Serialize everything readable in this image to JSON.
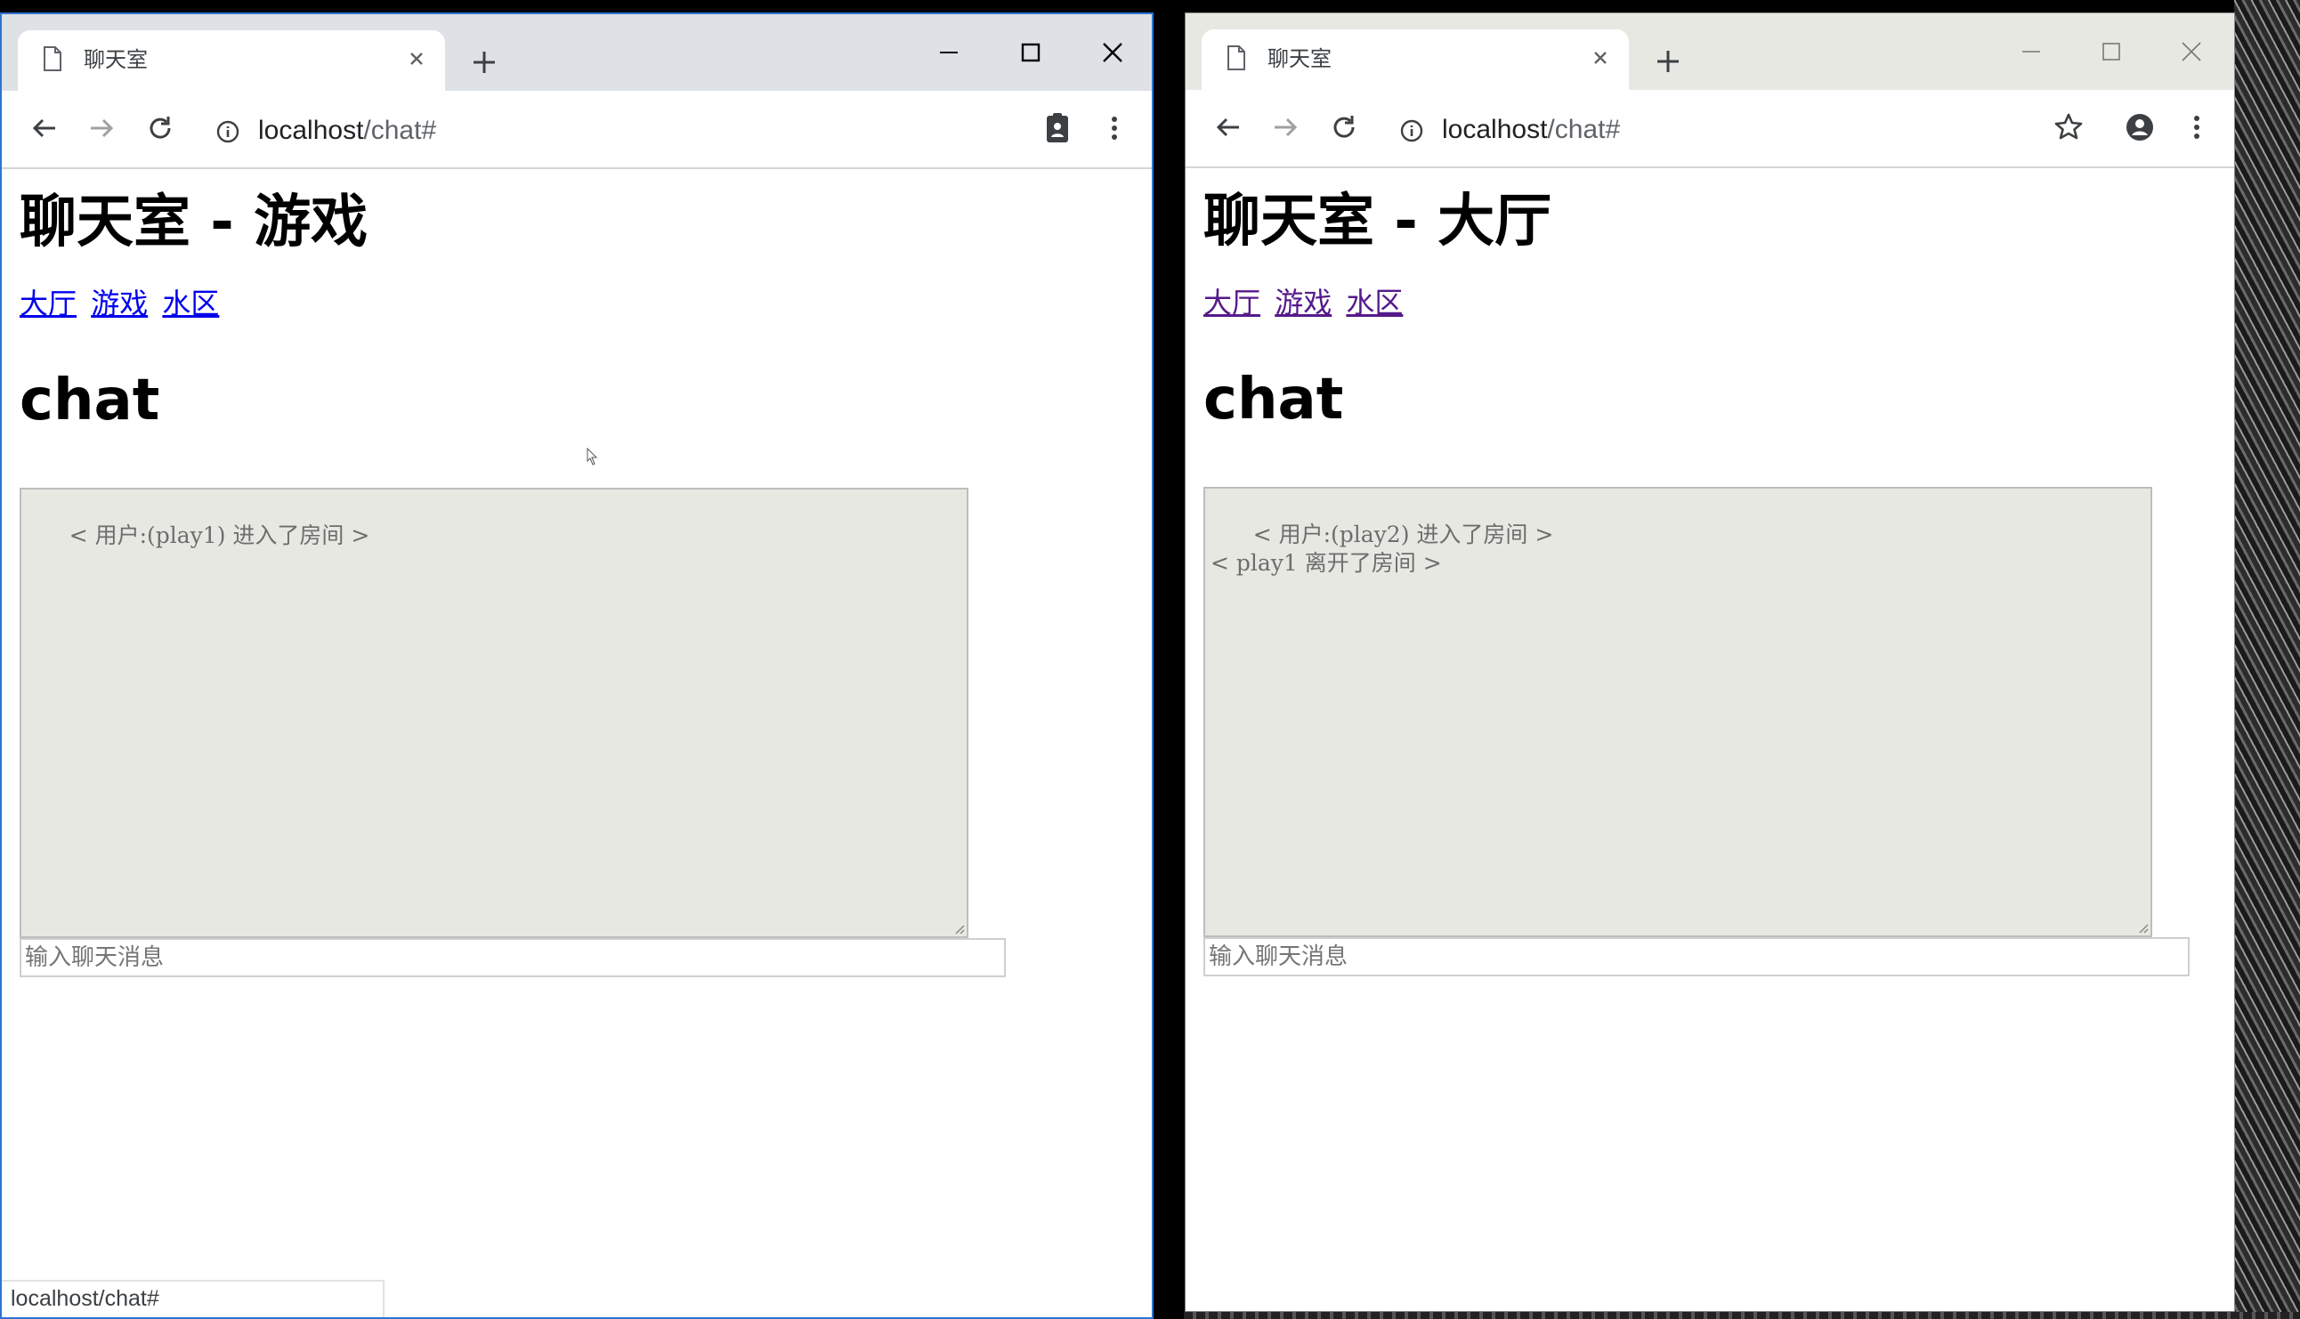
{
  "left_window": {
    "tab_title": "聊天室",
    "url_host": "localhost",
    "url_path": "/chat#",
    "heading": "聊天室 - 游戏",
    "links": [
      "大厅",
      "游戏",
      "水区"
    ],
    "section_heading": "chat",
    "chat_log": "< 用户:(play1) 进入了房间 >",
    "input_placeholder": "输入聊天消息",
    "status_url": "localhost/chat#",
    "icons": [
      "doc-icon",
      "close-icon",
      "plus-icon",
      "minimize-icon",
      "maximize-icon",
      "close-window-icon",
      "back-icon",
      "forward-icon",
      "reload-icon",
      "info-icon",
      "clipboard-icon",
      "menu-icon"
    ]
  },
  "right_window": {
    "tab_title": "聊天室",
    "url_host": "localhost",
    "url_path": "/chat#",
    "heading": "聊天室 - 大厅",
    "links": [
      "大厅",
      "游戏",
      "水区"
    ],
    "section_heading": "chat",
    "chat_log": "< 用户:(play2) 进入了房间 >\n< play1 离开了房间 >",
    "input_placeholder": "输入聊天消息",
    "icons": [
      "doc-icon",
      "close-icon",
      "plus-icon",
      "minimize-icon",
      "maximize-icon",
      "close-window-icon",
      "back-icon",
      "forward-icon",
      "reload-icon",
      "info-icon",
      "star-icon",
      "account-icon",
      "menu-icon"
    ]
  },
  "colors": {
    "active_border": "#2f74d0",
    "link": "#0000ee",
    "visited_link": "#551a8b",
    "chat_bg": "#e8e8e3"
  }
}
